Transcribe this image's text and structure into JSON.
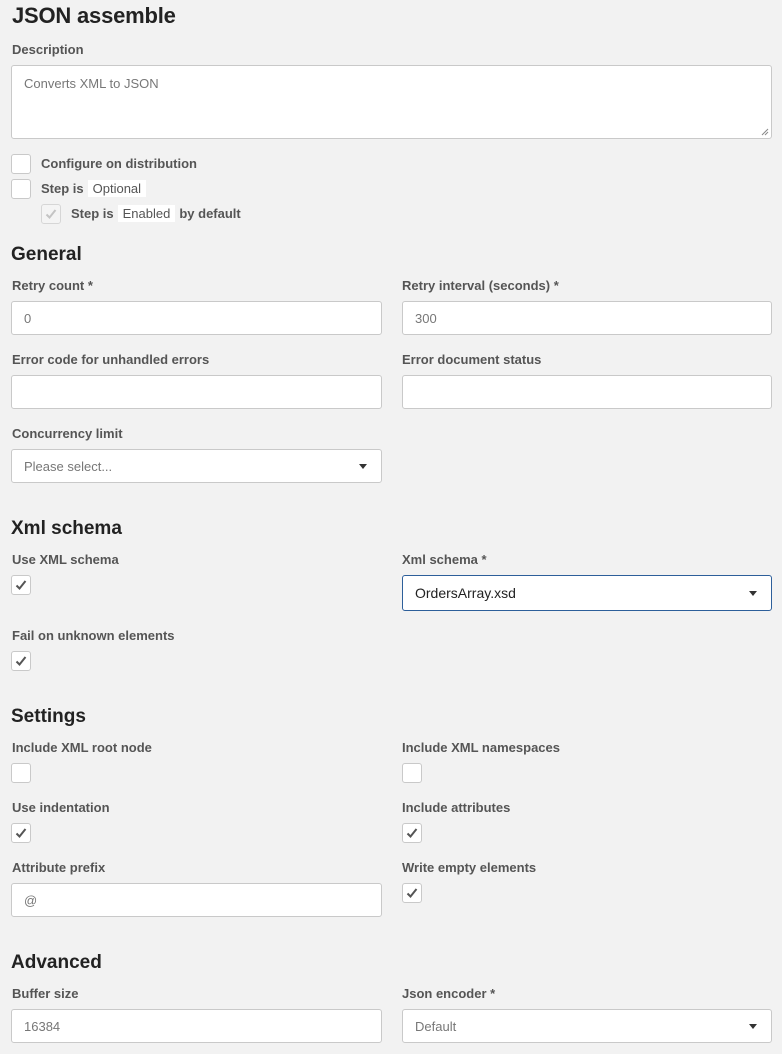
{
  "header": {
    "title": "JSON assemble"
  },
  "description": {
    "label": "Description",
    "value": "Converts XML to JSON"
  },
  "options": {
    "configure_on_distribution": {
      "label": "Configure on distribution",
      "checked": false
    },
    "step_optional": {
      "prefix": "Step is",
      "chip": "Optional",
      "checked": false
    },
    "step_enabled": {
      "prefix": "Step is",
      "chip": "Enabled",
      "suffix": "by default",
      "checked": true,
      "disabled": true
    }
  },
  "general": {
    "title": "General",
    "retry_count": {
      "label": "Retry count *",
      "value": "0"
    },
    "retry_interval": {
      "label": "Retry interval (seconds) *",
      "value": "300"
    },
    "error_code": {
      "label": "Error code for unhandled errors",
      "value": ""
    },
    "error_status": {
      "label": "Error document status",
      "value": ""
    },
    "concurrency": {
      "label": "Concurrency limit",
      "placeholder": "Please select..."
    }
  },
  "xml_schema": {
    "title": "Xml schema",
    "use_xml_schema": {
      "label": "Use XML schema",
      "checked": true
    },
    "schema": {
      "label": "Xml schema *",
      "value": "OrdersArray.xsd"
    },
    "fail_unknown": {
      "label": "Fail on unknown elements",
      "checked": true
    }
  },
  "settings": {
    "title": "Settings",
    "include_root": {
      "label": "Include XML root node",
      "checked": false
    },
    "include_namespaces": {
      "label": "Include XML namespaces",
      "checked": false
    },
    "use_indentation": {
      "label": "Use indentation",
      "checked": true
    },
    "include_attributes": {
      "label": "Include attributes",
      "checked": true
    },
    "attribute_prefix": {
      "label": "Attribute prefix",
      "value": "@"
    },
    "write_empty": {
      "label": "Write empty elements",
      "checked": true
    }
  },
  "advanced": {
    "title": "Advanced",
    "buffer_size": {
      "label": "Buffer size",
      "value": "16384"
    },
    "json_encoder": {
      "label": "Json encoder *",
      "value": "Default"
    }
  },
  "icons": {
    "check": "check-icon",
    "dropdown": "chevron-down-icon"
  },
  "colors": {
    "background": "#f2f2f2",
    "border": "#c9c9c9",
    "focus_border": "#2d5f9a"
  }
}
